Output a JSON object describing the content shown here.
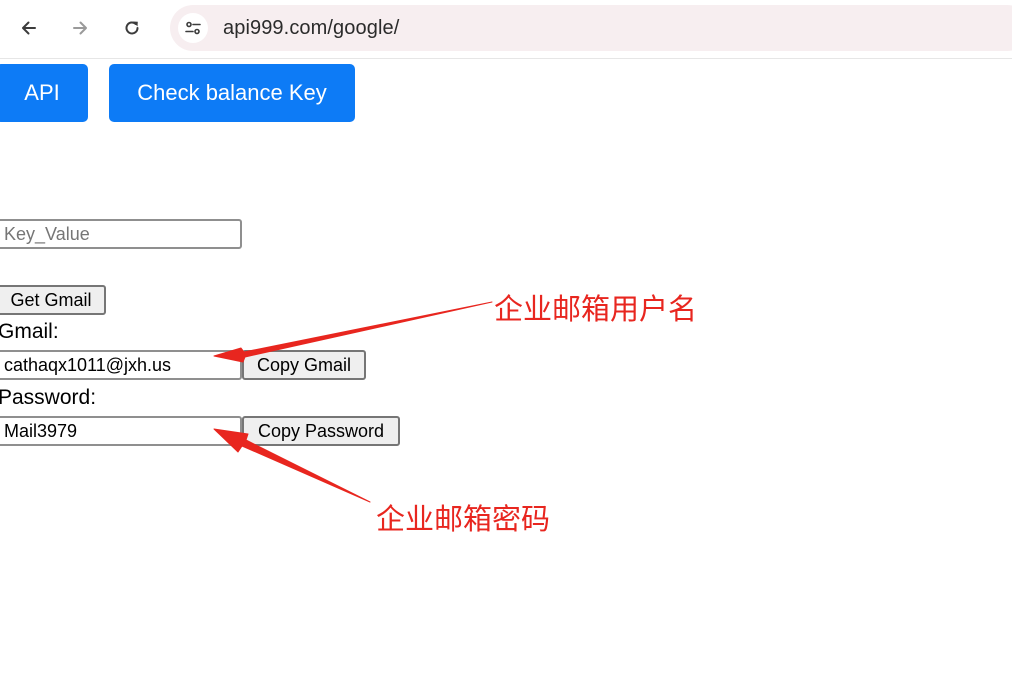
{
  "browser": {
    "url": "api999.com/google/",
    "icons": {
      "back": "arrow-left-icon",
      "forward": "arrow-right-icon",
      "reload": "reload-icon",
      "site_settings": "tune-icon"
    }
  },
  "buttons": {
    "api_label": "API",
    "check_balance_label": "Check balance Key",
    "get_gmail_label": "Get Gmail",
    "copy_gmail_label": "Copy Gmail",
    "copy_password_label": "Copy Password"
  },
  "form": {
    "key_placeholder": "Key_Value",
    "gmail_label": "Gmail:",
    "gmail_value": "cathaqx1011@jxh.us",
    "password_label": "Password:",
    "password_value": "Mail3979"
  },
  "annotations": {
    "username_note": "企业邮箱用户名",
    "password_note": "企业邮箱密码",
    "color": "#e8261f"
  },
  "colors": {
    "primary_button": "#0d7bf6",
    "omnibox_bg": "#f7eef0"
  }
}
